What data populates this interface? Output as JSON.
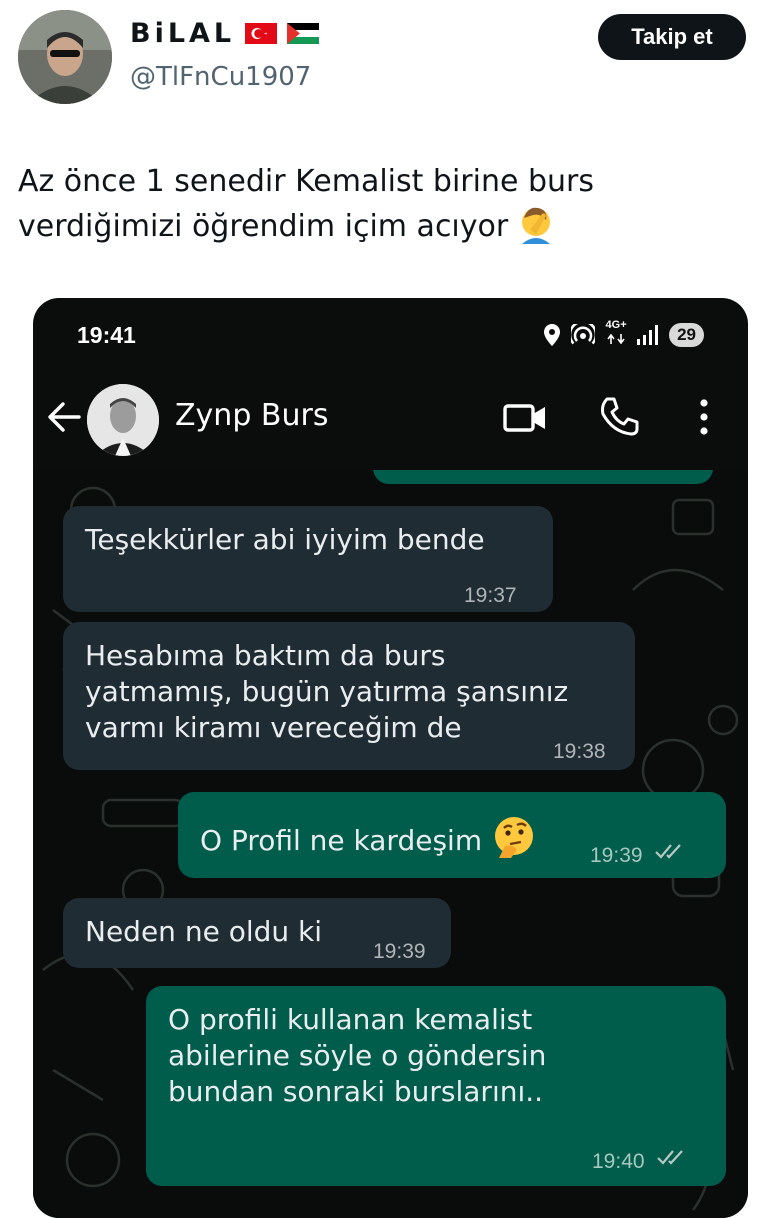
{
  "tweet": {
    "author_name": "BiLAL",
    "handle": "@TlFnCu1907",
    "follow_label": "Takip et",
    "text_line1": "Az önce 1 senedir Kemalist birine burs",
    "text_line2": "verdiğimizi öğrendim içim acıyor",
    "text_emoji": "facepalm-emoji",
    "flags": [
      "turkey-flag-icon",
      "palestine-flag-icon"
    ]
  },
  "phone": {
    "status": {
      "time": "19:41",
      "network_top": "4G+",
      "battery": "29"
    },
    "contact_name": "Zynp Burs",
    "messages": [
      {
        "type": "incoming",
        "text": "Teşekkürler abi iyiyim bende",
        "time": "19:37"
      },
      {
        "type": "incoming",
        "text": "Hesabıma baktım da burs\nyatmamış, bugün yatırma şansınız\nvarmı kiramı vereceğim de",
        "time": "19:38"
      },
      {
        "type": "outgoing",
        "text": "O Profil ne kardeşim",
        "emoji": "thinking-face-emoji",
        "time": "19:39",
        "status": "read"
      },
      {
        "type": "incoming",
        "text": "Neden ne oldu ki",
        "time": "19:39"
      },
      {
        "type": "outgoing",
        "text": "O profili kullanan kemalist\nabilerine söyle o göndersin\nbundan sonraki burslarını..",
        "time": "19:40",
        "status": "read"
      }
    ]
  },
  "colors": {
    "follow_button": "#0f1419",
    "incoming_bubble": "#202c33",
    "outgoing_bubble": "#005c4b",
    "chat_background": "#0a0c0b"
  }
}
